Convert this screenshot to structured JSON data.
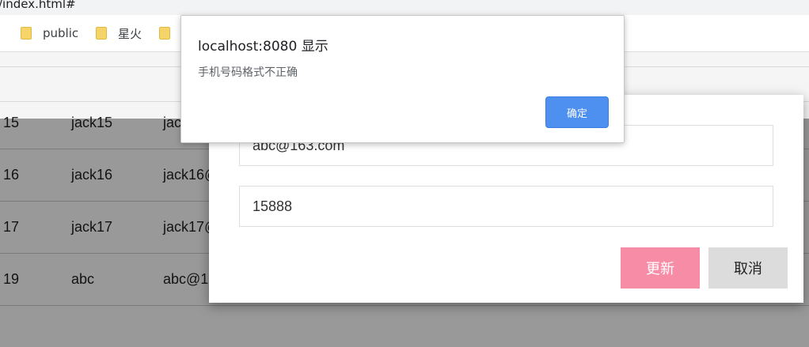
{
  "browser": {
    "url_fragment": "/index.html#",
    "bookmarks": [
      {
        "label": "public",
        "icon": "folder-icon"
      },
      {
        "label": "星火",
        "icon": "folder-icon"
      },
      {
        "label": "",
        "icon": "folder-icon"
      }
    ]
  },
  "table": {
    "rows": [
      {
        "id": "15",
        "name": "jack15",
        "email": "jack15"
      },
      {
        "id": "16",
        "name": "jack16",
        "email": "jack16@"
      },
      {
        "id": "17",
        "name": "jack17",
        "email": "jack17@"
      },
      {
        "id": "19",
        "name": "abc",
        "email": "abc@1"
      }
    ]
  },
  "edit_modal": {
    "email_value": "abc@163.com",
    "phone_value": "15888",
    "update_label": "更新",
    "cancel_label": "取消"
  },
  "alert": {
    "title": "localhost:8080 显示",
    "message": "手机号码格式不正确",
    "ok_label": "确定"
  },
  "colors": {
    "update_button": "#f78ca6",
    "cancel_button": "#dcdcdc",
    "ok_button": "#4d90f0",
    "overlay": "rgba(0,0,0,0.4)"
  }
}
